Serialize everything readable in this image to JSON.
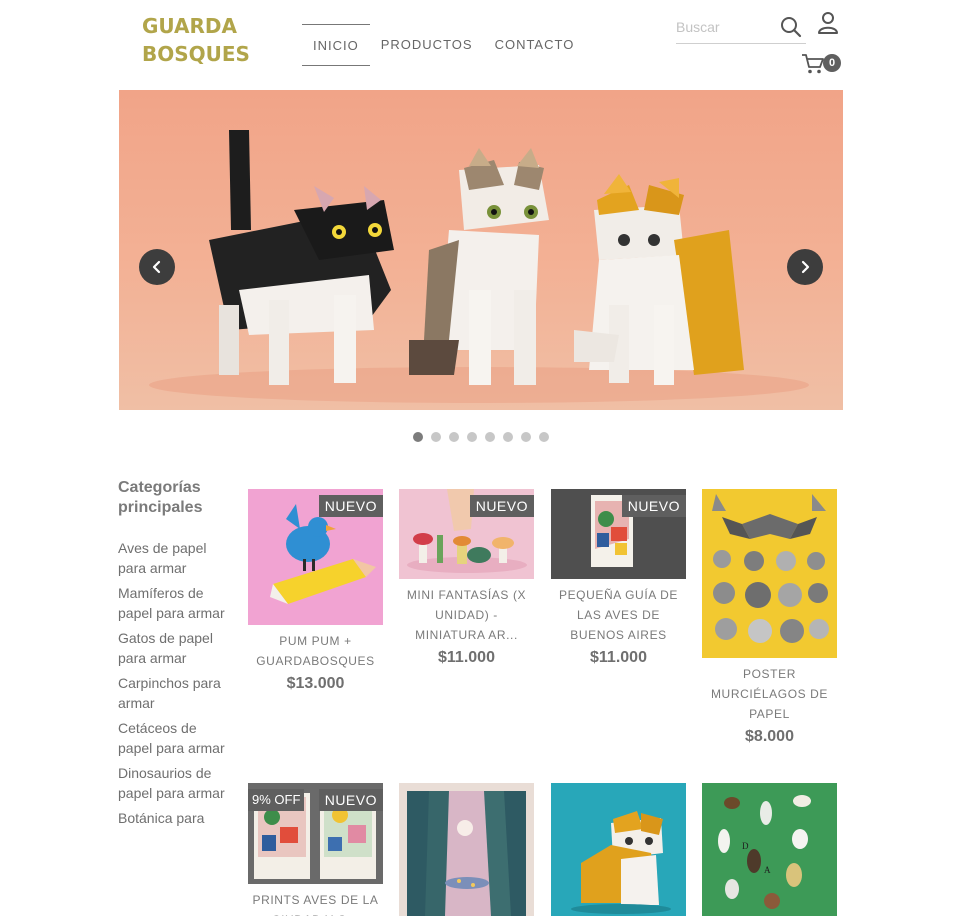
{
  "brand": {
    "line1": "GUARDA",
    "line2": "BOSQUES"
  },
  "nav": [
    "INICIO",
    "PRODUCTOS",
    "CONTACTO"
  ],
  "search": {
    "placeholder": "Buscar"
  },
  "cart": {
    "count": "0"
  },
  "slider": {
    "slide_count": 8,
    "active_index": 0
  },
  "colors": {
    "accent": "#b1a54a",
    "badge": "#5f5f5f",
    "hero_bg": "#f2ab8f"
  },
  "sidebar": {
    "title": "Categorías principales",
    "items": [
      "Aves de papel para armar",
      "Mamíferos de papel para armar",
      "Gatos de papel para armar",
      "Carpinchos para armar",
      "Cetáceos de papel para armar",
      "Dinosaurios de papel para armar",
      "Botánica para"
    ]
  },
  "products": [
    {
      "name": "PUM PUM + GUARDABOSQUES",
      "price": "$13.000",
      "badge": "NUEVO"
    },
    {
      "name": "MINI FANTASÍAS (X UNIDAD) - MINIATURA AR...",
      "price": "$11.000",
      "badge": "NUEVO"
    },
    {
      "name": "PEQUEÑA GUÍA DE LAS AVES DE BUENOS AIRES",
      "price": "$11.000",
      "badge": "NUEVO"
    },
    {
      "name": "POSTER MURCIÉLAGOS DE PAPEL",
      "price": "$8.000",
      "badge": ""
    },
    {
      "name": "PRINTS AVES DE LA CIUDAD Y O...",
      "price": "",
      "badge": "NUEVO",
      "discount": "9% OFF"
    },
    {
      "name": "",
      "price": "",
      "badge": ""
    },
    {
      "name": "",
      "price": "",
      "badge": ""
    },
    {
      "name": "",
      "price": "",
      "badge": ""
    }
  ]
}
